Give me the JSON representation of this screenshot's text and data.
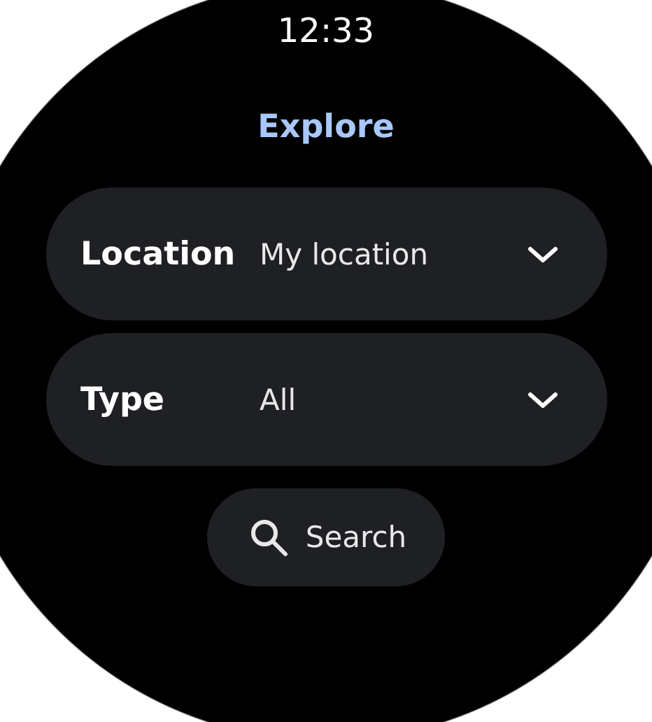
{
  "status_bar": {
    "time": "12:33"
  },
  "title": "Explore",
  "filters": [
    {
      "label": "Location",
      "value": "My location"
    },
    {
      "label": "Type",
      "value": "All"
    }
  ],
  "search_button": {
    "label": "Search"
  }
}
